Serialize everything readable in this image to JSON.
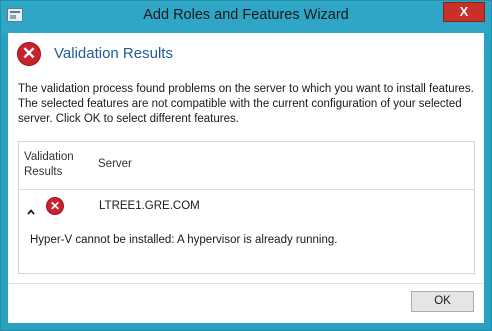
{
  "window": {
    "title": "Add Roles and Features Wizard",
    "close_symbol": "X",
    "app_icon": "wizard-window-icon"
  },
  "header": {
    "icon": "error-icon",
    "title": "Validation Results"
  },
  "description": "The validation process found problems on the server to which you want to install features. The selected features are not compatible with the current configuration of your selected server.  Click OK to select different features.",
  "table": {
    "columns": [
      "Validation Results",
      "Server"
    ],
    "rows": [
      {
        "expanded": true,
        "status_icon": "error-icon",
        "server": "LTREE1.GRE.COM",
        "detail": "Hyper-V cannot be installed: A hypervisor is already running."
      }
    ]
  },
  "buttons": {
    "ok_label": "OK"
  },
  "colors": {
    "title_bar": "#2fa6c6",
    "close_button": "#c7312a",
    "error_red": "#c8232c",
    "header_blue": "#1f5c96"
  }
}
